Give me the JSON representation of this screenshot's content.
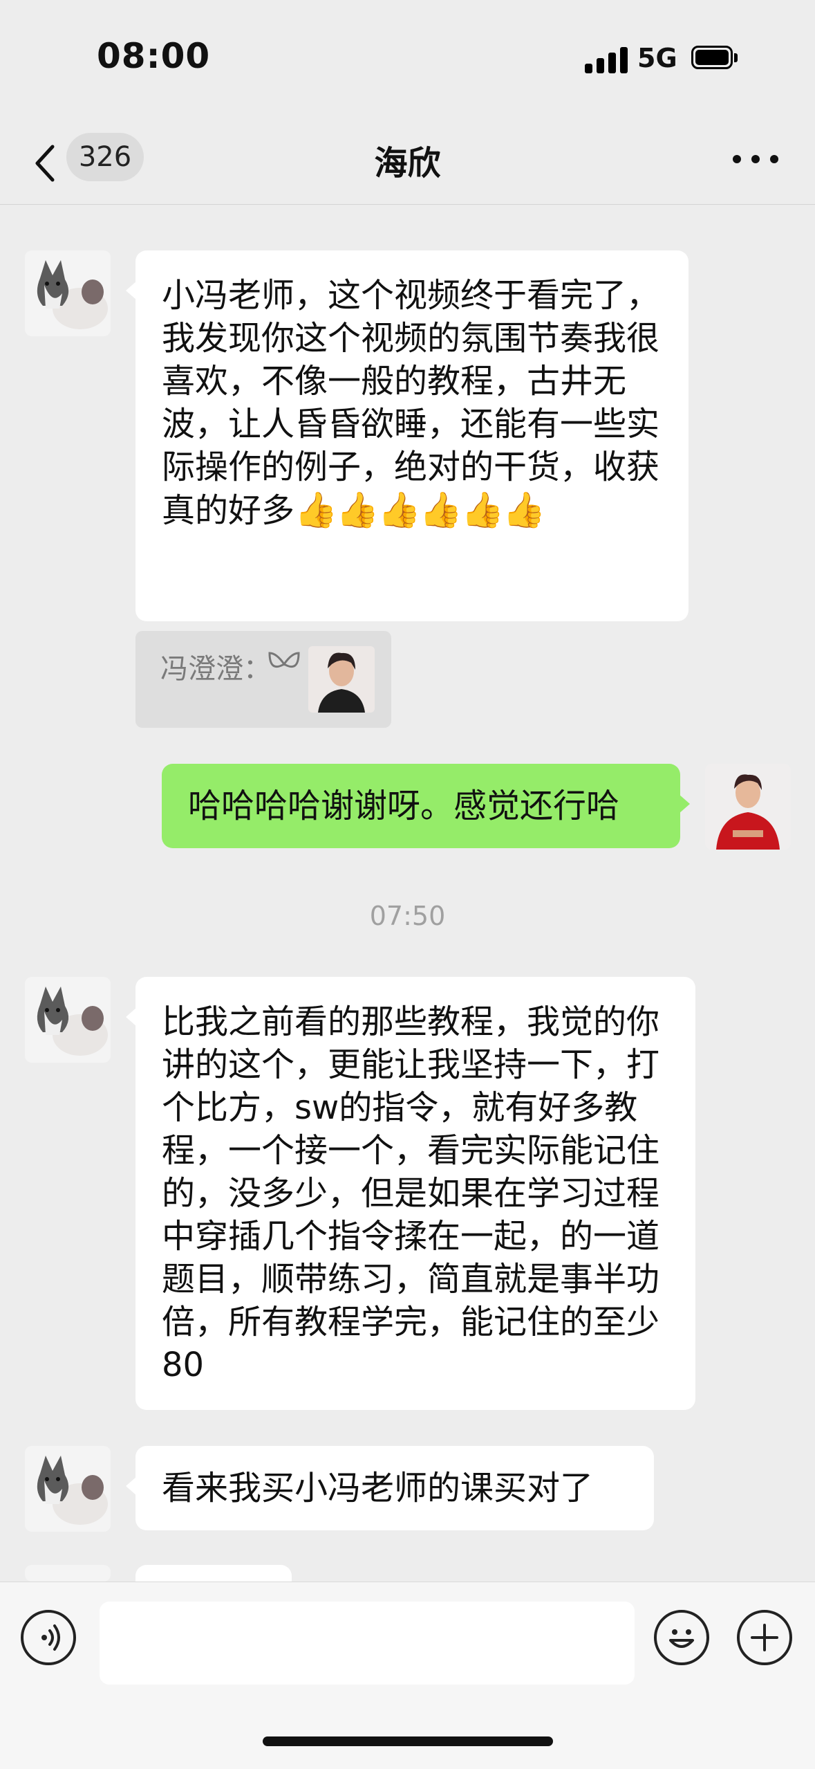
{
  "status_bar": {
    "time": "08:00",
    "network": "5G"
  },
  "nav": {
    "unread_count": "326",
    "title": "海欣"
  },
  "messages": [
    {
      "side": "left",
      "text": "小冯老师，这个视频终于看完了，我发现你这个视频的氛围节奏我很喜欢，不像一般的教程，古井无波，让人昏昏欲睡，还能有一些实际操作的例子，绝对的干货，收获真的好多",
      "emoji": "👍👍👍👍👍👍"
    },
    {
      "type": "quote",
      "text": "冯澄澄："
    },
    {
      "side": "right",
      "text": "哈哈哈哈谢谢呀。感觉还行哈"
    },
    {
      "type": "timestamp",
      "text": "07:50"
    },
    {
      "side": "left",
      "text": "比我之前看的那些教程，我觉的你讲的这个，更能让我坚持一下，打个比方，sw的指令，就有好多教程，一个接一个，看完实际能记住的，没多少，但是如果在学习过程中穿插几个指令揉在一起，的一道题目，顺带练习，简直就是事半功倍，所有教程学完，能记住的至少80"
    },
    {
      "side": "left",
      "text": "看来我买小冯老师的课买对了"
    }
  ],
  "input": {
    "placeholder": ""
  },
  "colors": {
    "background": "#ededed",
    "sent_bubble": "#95ec69",
    "received_bubble": "#ffffff"
  }
}
